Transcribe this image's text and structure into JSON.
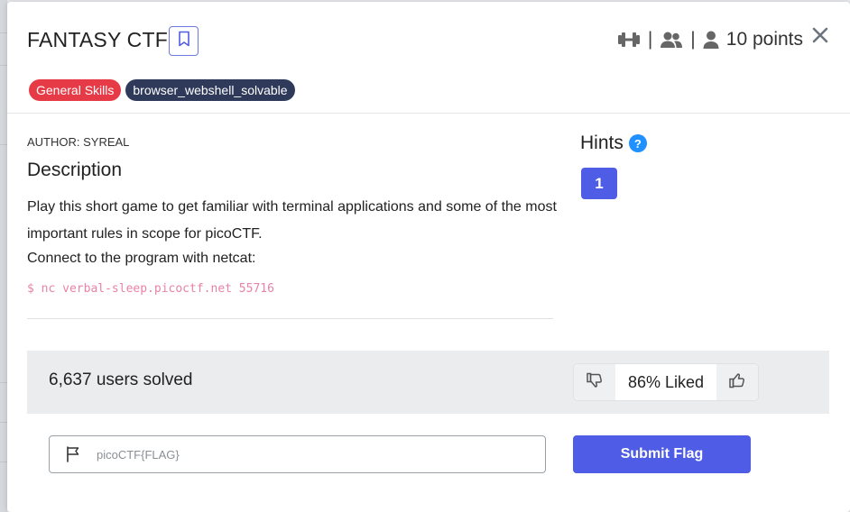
{
  "challenge": {
    "title": "FANTASY CTF",
    "points": "10 points",
    "separator": "|",
    "tags": [
      "General Skills",
      "browser_webshell_solvable"
    ],
    "author": "AUTHOR: SYREAL",
    "description_heading": "Description",
    "description_text": "Play this short game to get familiar with terminal applications and some of the most important rules in scope for picoCTF.",
    "connect_text": "Connect to the program with netcat:",
    "command": "$ nc verbal-sleep.picoctf.net 55716"
  },
  "hints": {
    "heading": "Hints",
    "help_glyph": "?",
    "items": [
      "1"
    ]
  },
  "stats": {
    "solved": "6,637 users solved",
    "liked": "86% Liked"
  },
  "flag_form": {
    "placeholder": "picoCTF{FLAG}",
    "submit_label": "Submit Flag"
  },
  "colors": {
    "accent": "#4f5ce6",
    "tag_red": "#e63a46",
    "tag_dark": "#2f3a5b",
    "command_pink": "#e783a8",
    "help_blue": "#1e90ff"
  },
  "icons": [
    "bookmark-icon",
    "dumbbell-icon",
    "users-icon",
    "user-icon",
    "close-icon",
    "question-icon",
    "thumbs-down-icon",
    "thumbs-up-icon",
    "flag-icon"
  ]
}
